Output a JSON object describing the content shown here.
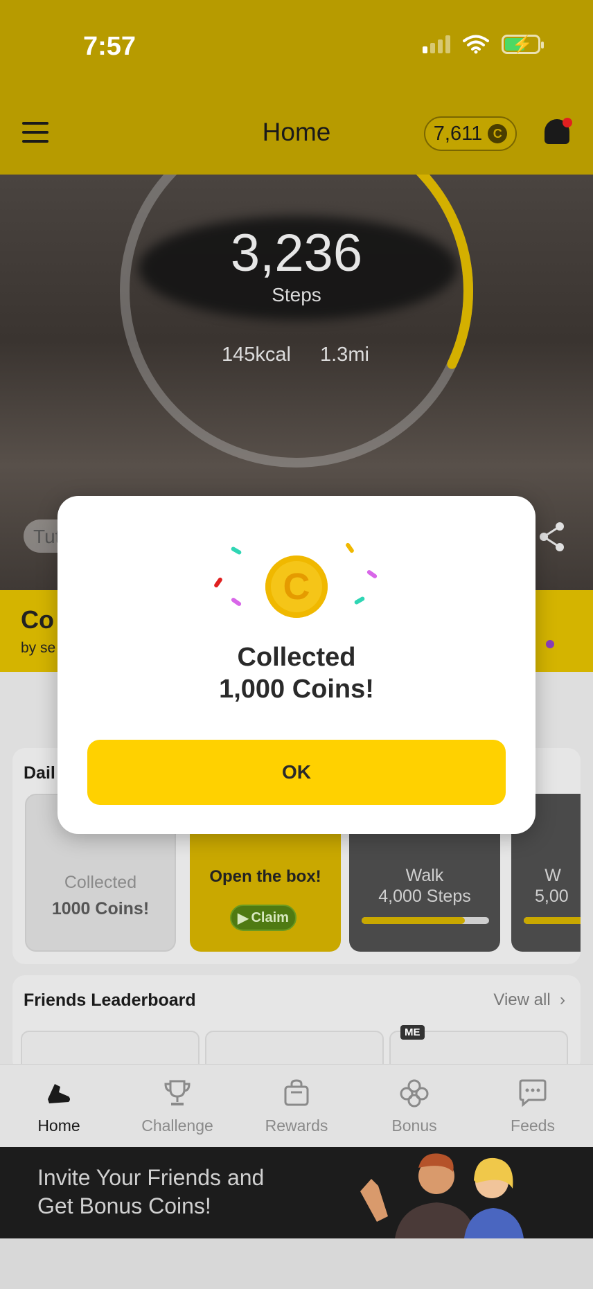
{
  "status_bar": {
    "time": "7:57",
    "battery_charging": true
  },
  "header": {
    "title": "Home",
    "coin_balance": "7,611",
    "coin_symbol": "C",
    "notification_dot_color": "#e02020"
  },
  "hero": {
    "steps": "3,236",
    "steps_label": "Steps",
    "kcal": "145kcal",
    "distance": "1.3mi",
    "ring_progress": 0.32,
    "tutorial_chip": "Tutorial"
  },
  "promo_band": {
    "title": "Co",
    "subtitle": "by se"
  },
  "daily": {
    "title": "Dail",
    "tiles": [
      {
        "line1": "Collected",
        "line2": "1000 Coins!"
      },
      {
        "line1": "Open the box!",
        "claim_label": "Claim"
      },
      {
        "line1": "Walk",
        "line2": "4,000 Steps",
        "progress": 0.81
      },
      {
        "line1": "W",
        "line2": "5,00",
        "progress": 0.6
      }
    ]
  },
  "leaderboard": {
    "title": "Friends Leaderboard",
    "view_all": "View all",
    "me_badge": "ME"
  },
  "tabs": [
    {
      "label": "Home",
      "icon": "shoe-icon",
      "active": true
    },
    {
      "label": "Challenge",
      "icon": "trophy-icon",
      "active": false
    },
    {
      "label": "Rewards",
      "icon": "shopping-bag-icon",
      "active": false
    },
    {
      "label": "Bonus",
      "icon": "clover-icon",
      "active": false
    },
    {
      "label": "Feeds",
      "icon": "chat-bubble-icon",
      "active": false
    }
  ],
  "banner": {
    "line1": "Invite Your Friends and",
    "line2": "Get Bonus Coins!"
  },
  "modal": {
    "title_line1": "Collected",
    "title_line2": "1,000 Coins!",
    "ok_label": "OK",
    "coin_symbol": "C"
  },
  "colors": {
    "accent": "#ffd100",
    "header_dimmed": "#b79b00",
    "ring": "#d4b000"
  }
}
